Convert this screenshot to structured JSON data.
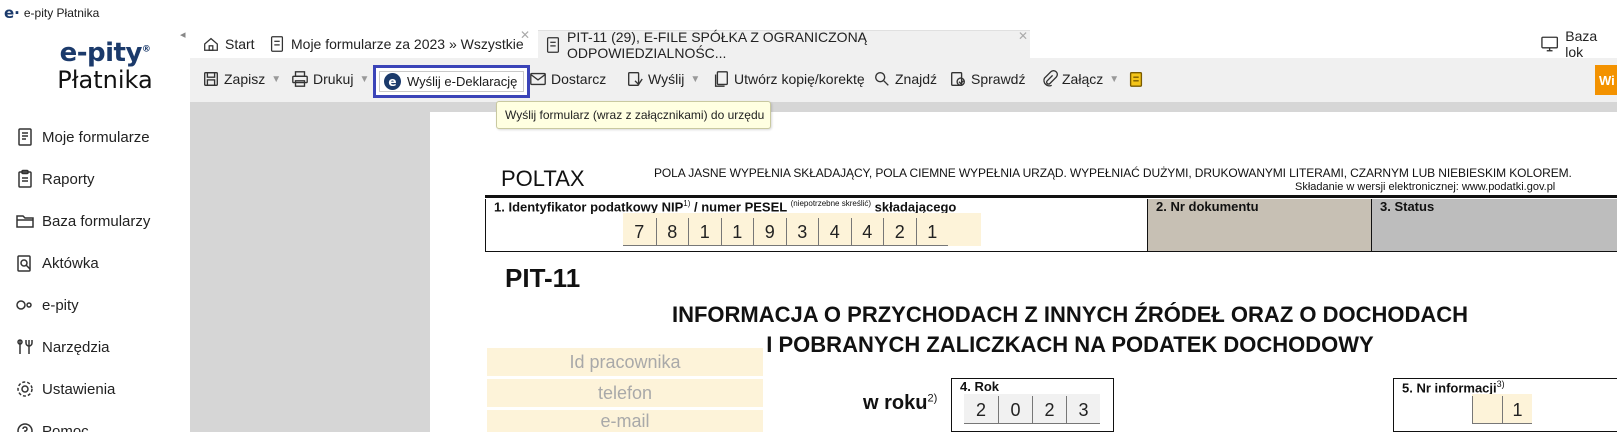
{
  "window": {
    "title": "e-pity Płatnika",
    "logo_glyph": "e·"
  },
  "brand": {
    "line1": "e-pity",
    "reg": "®",
    "line2": "Płatnika"
  },
  "sidebar": {
    "items": [
      {
        "label": "Moje formularze",
        "icon": "document-icon"
      },
      {
        "label": "Raporty",
        "icon": "clipboard-icon"
      },
      {
        "label": "Baza formularzy",
        "icon": "folder-icon"
      },
      {
        "label": "Aktówka",
        "icon": "briefcase-icon"
      },
      {
        "label": "e-pity",
        "icon": "epity-icon"
      },
      {
        "label": "Narzędzia",
        "icon": "tools-icon"
      },
      {
        "label": "Ustawienia",
        "icon": "gear-icon"
      },
      {
        "label": "Pomoc",
        "icon": "help-icon"
      }
    ]
  },
  "tabs": {
    "start": "Start",
    "my_forms": "Moje formularze za 2023 » Wszystkie",
    "current": "PIT-11 (29), E-FILE SPÓŁKA Z OGRANICZONĄ ODPOWIEDZIALNOŚC...",
    "close_glyph": "✕",
    "baza": "Baza lok"
  },
  "toolbar": {
    "save": "Zapisz",
    "print": "Drukuj",
    "send_edecl": "Wyślij e-Deklarację",
    "deliver": "Dostarcz",
    "send": "Wyślij",
    "copy": "Utwórz kopię/korektę",
    "find": "Znajdź",
    "check": "Sprawdź",
    "attach": "Załącz",
    "right_btn": "Wi"
  },
  "tooltip": {
    "text": "Wyślij formularz (wraz z załącznikami) do urzędu"
  },
  "form": {
    "poltax": "POLTAX",
    "fill_note": "POLA JASNE WYPEŁNIA SKŁADAJĄCY, POLA CIEMNE WYPEŁNIA URZĄD. WYPEŁNIAĆ DUŻYMI, DRUKOWANYMI LITERAMI, CZARNYM LUB NIEBIESKIM KOLOREM.",
    "efile_note": "Składanie w wersji elektronicznej: www.podatki.gov.pl",
    "field1_label_a": "1. Identyfikator podatkowy NIP",
    "field1_sup1": "1)",
    "field1_label_b": " / numer PESEL ",
    "field1_small": "(niepotrzebne skreślić)",
    "field1_label_c": " składającego",
    "nip_digits": [
      "7",
      "8",
      "1",
      "1",
      "9",
      "3",
      "4",
      "4",
      "2",
      "1"
    ],
    "field2_label": "2. Nr dokumentu",
    "field3_label": "3. Status",
    "pit_title": "PIT-11",
    "heading_line1": "INFORMACJA O PRZYCHODACH Z INNYCH ŹRÓDEŁ ORAZ O DOCHODACH",
    "heading_line2": "I POBRANYCH ZALICZKACH NA PODATEK DOCHODOWY",
    "emp_id": "Id pracownika",
    "emp_phone": "telefon",
    "emp_email": "e-mail",
    "w_roku": "w roku",
    "w_roku_sup": "2)",
    "field4_label": "4. Rok",
    "year_digits": [
      "2",
      "0",
      "2",
      "3"
    ],
    "field5_label": "5. Nr informacji",
    "field5_sup": "3)",
    "info_digits": [
      "",
      "1"
    ]
  }
}
